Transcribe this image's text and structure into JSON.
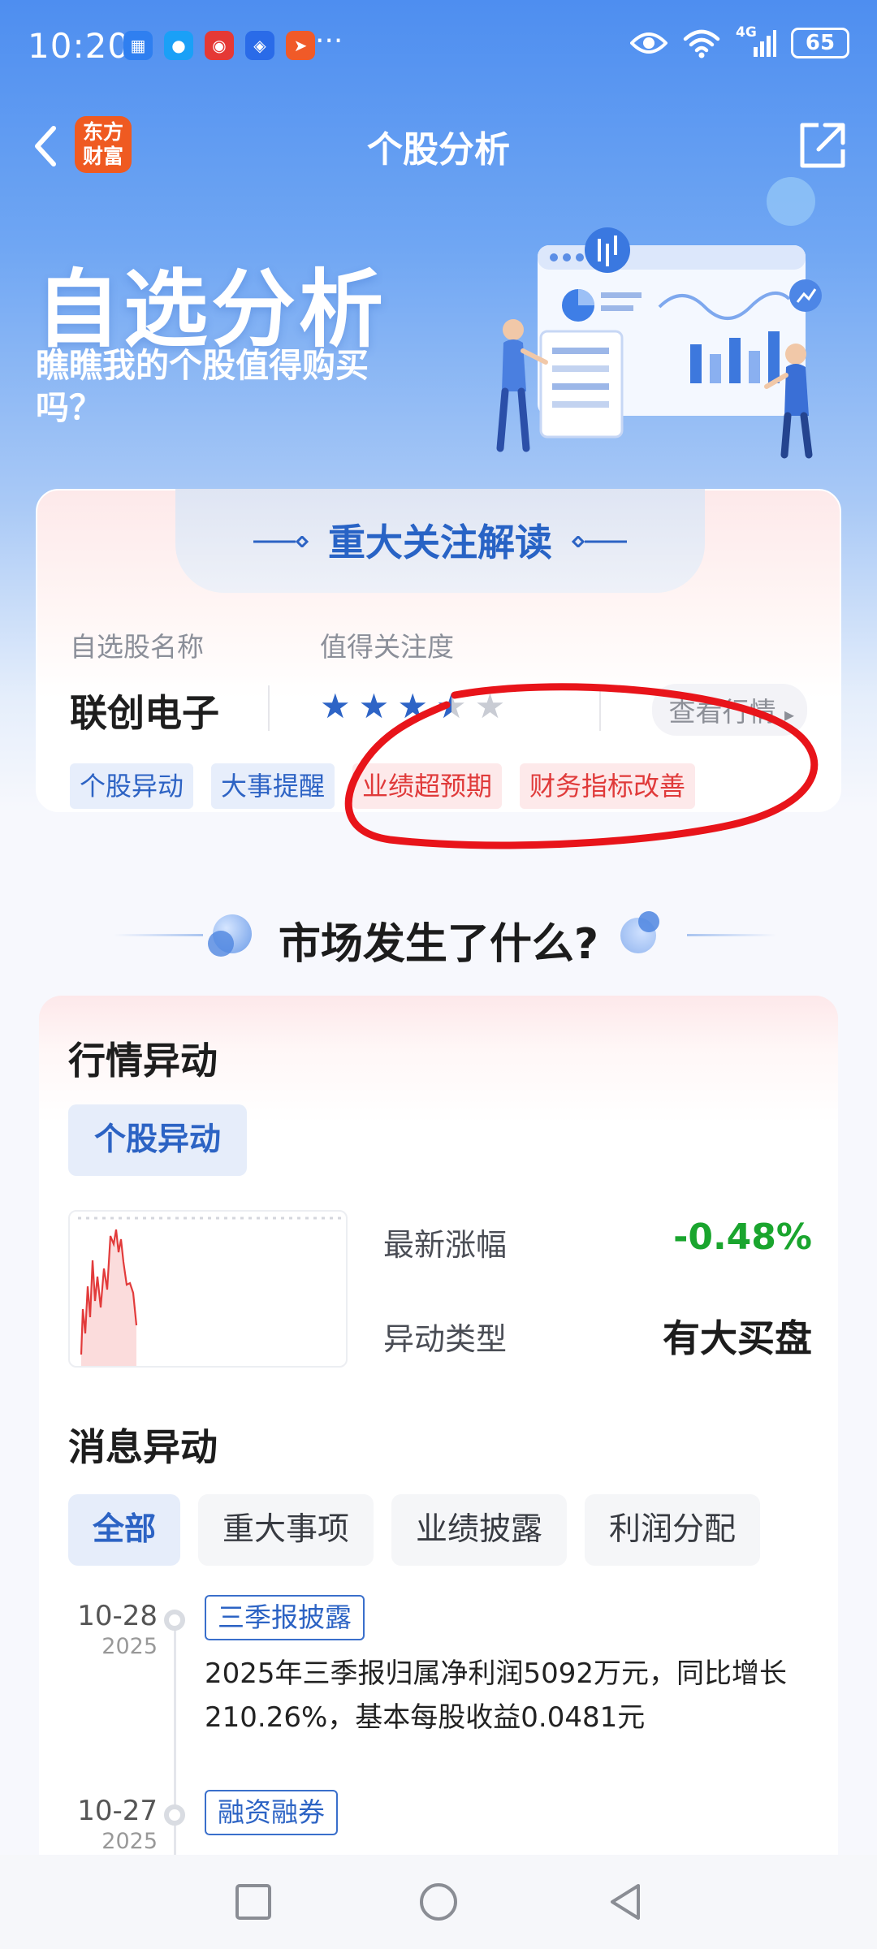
{
  "status_bar": {
    "time": "10:20",
    "more": "···",
    "network": "4G",
    "battery": "65"
  },
  "header": {
    "logo_text": "东方\n财富",
    "title": "个股分析"
  },
  "hero": {
    "title": "自选分析",
    "subtitle": "瞧瞧我的个股值得购买吗？"
  },
  "focus_card": {
    "title": "重大关注解读",
    "col_name_label": "自选股名称",
    "col_attention_label": "值得关注度",
    "stock_name": "联创电子",
    "rating": 3.5,
    "rating_max": 5,
    "view_market_label": "查看行情",
    "tags": [
      {
        "label": "个股异动",
        "color": "blue"
      },
      {
        "label": "大事提醒",
        "color": "blue"
      },
      {
        "label": "业绩超预期",
        "color": "red"
      },
      {
        "label": "财务指标改善",
        "color": "red"
      }
    ]
  },
  "market_section": {
    "title": "市场发生了什么?"
  },
  "quote_anomaly": {
    "heading": "行情异动",
    "pill": "个股异动",
    "latest_change_label": "最新涨幅",
    "latest_change_value": "-0.48%",
    "anomaly_type_label": "异动类型",
    "anomaly_type_value": "有大买盘",
    "value_colors": {
      "change": "#1aa52e",
      "type": "#1d1d1d"
    }
  },
  "news_anomaly": {
    "heading": "消息异动",
    "filters": [
      "全部",
      "重大事项",
      "业绩披露",
      "利润分配"
    ],
    "active_filter": "全部",
    "items": [
      {
        "date": "10-28",
        "year": "2025",
        "tag": "三季报披露",
        "text": "2025年三季报归属净利润5092万元，同比增长210.26%，基本每股收益0.0481元"
      },
      {
        "date": "10-27",
        "year": "2025",
        "tag": "融资融券",
        "text": ""
      }
    ]
  },
  "colors": {
    "accent_blue": "#2c63c4",
    "alert_red": "#e03a3a",
    "positive_green": "#1aa52e",
    "annotation": "#e8141a"
  }
}
